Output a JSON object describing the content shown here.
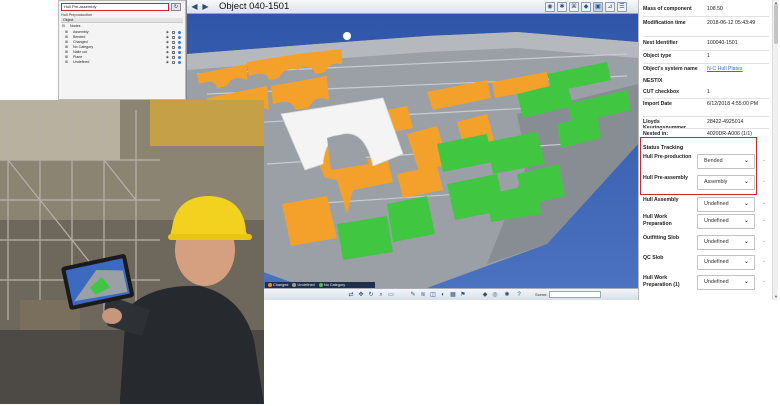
{
  "tree": {
    "filter_value": "Hull Pre-assembly",
    "breadcrumb": "Hull Preproduction",
    "column_header": "Object",
    "root": "Nodes",
    "items": [
      {
        "label": "Assembly",
        "eye": "visible"
      },
      {
        "label": "Bended",
        "eye": "visible"
      },
      {
        "label": "Changed",
        "eye": "visible"
      },
      {
        "label": "No Category",
        "eye": "visible"
      },
      {
        "label": "Nalle cut",
        "eye": "visible"
      },
      {
        "label": "Plane",
        "eye": "visible"
      },
      {
        "label": "Undefined",
        "eye": "visible"
      }
    ]
  },
  "viewer": {
    "title": "Object 040-1501",
    "legend": [
      {
        "label": "Changed",
        "color": "#f08a24"
      },
      {
        "label": "Undefined",
        "color": "#9aa0a8"
      },
      {
        "label": "No Category",
        "color": "#4cc24c"
      }
    ],
    "scene_label": "Scene:",
    "colors": {
      "sky": "#3e64b3",
      "hull": "#9da2a8",
      "frame_orange": "#f3a12a",
      "frame_green": "#41c641",
      "highlight": "#ffffff"
    }
  },
  "properties": {
    "rows": [
      {
        "key": "Mass of component",
        "value": "108.50"
      },
      {
        "key": "Modification time",
        "value": "2018-06-12 05:43:49"
      },
      {
        "key": "Nest Identifier",
        "value": "100040-1501"
      },
      {
        "key": "Object type",
        "value": "1"
      },
      {
        "key": "Object's system name",
        "value": "N-C Hull Plates",
        "link": true
      }
    ],
    "section_nestix": "NESTIX",
    "nestix_rows": [
      {
        "key": "CUT checkbox",
        "value": "1"
      },
      {
        "key": "Import Date",
        "value": "6/12/2018 4:55:00 PM"
      },
      {
        "key": "Lloyds Keuringsnummer",
        "value": "28422-4925014"
      },
      {
        "key": "Nested in:",
        "value": "4020DR-A006 (1/1)"
      }
    ],
    "section_status": "Status Tracking",
    "status_rows": [
      {
        "key": "Hull Pre-production",
        "value": "Bended"
      },
      {
        "key": "Hull Pre-assembly",
        "value": "Assembly"
      },
      {
        "key": "Hull Assembly",
        "value": "Undefined"
      },
      {
        "key": "Hull Work Preparation",
        "value": "Undefined"
      },
      {
        "key": "Outfitting Slob",
        "value": "Undefined"
      },
      {
        "key": "QC Slob",
        "value": "Undefined"
      },
      {
        "key": "Hull Work Preparation (1)",
        "value": "Undefined"
      }
    ]
  }
}
